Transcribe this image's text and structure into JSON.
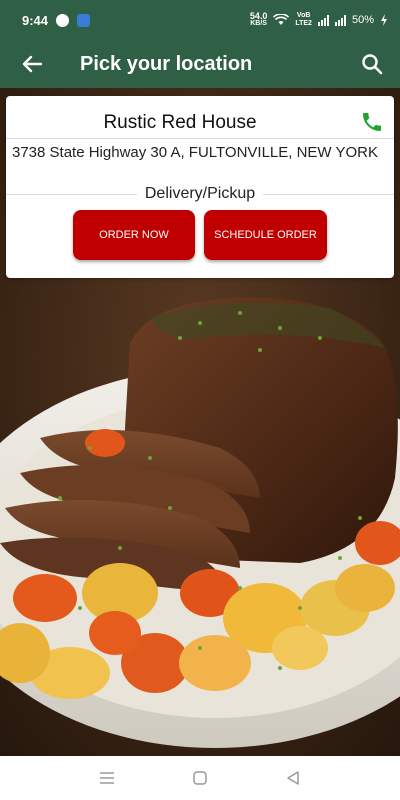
{
  "status_bar": {
    "time": "9:44",
    "net_speed_value": "54.0",
    "net_speed_unit": "KB/S",
    "network_label_top": "VoB",
    "network_label_bottom": "LTE2",
    "battery": "50%"
  },
  "app_bar": {
    "title": "Pick your location",
    "back_icon": "arrow-left-icon",
    "search_icon": "search-icon"
  },
  "location_card": {
    "name": "Rustic Red House",
    "address": "3738 State Highway 30 A, FULTONVILLE, NEW YORK",
    "service_type": "Delivery/Pickup",
    "order_now_label": "ORDER NOW",
    "schedule_order_label": "SCHEDULE ORDER",
    "phone_icon": "phone-icon"
  },
  "colors": {
    "header_green": "#2f5f44",
    "button_red": "#c00000",
    "phone_green": "#1fa52b"
  },
  "nav_bar": {
    "icons": [
      "menu-icon",
      "home-square-icon",
      "back-triangle-icon"
    ]
  }
}
